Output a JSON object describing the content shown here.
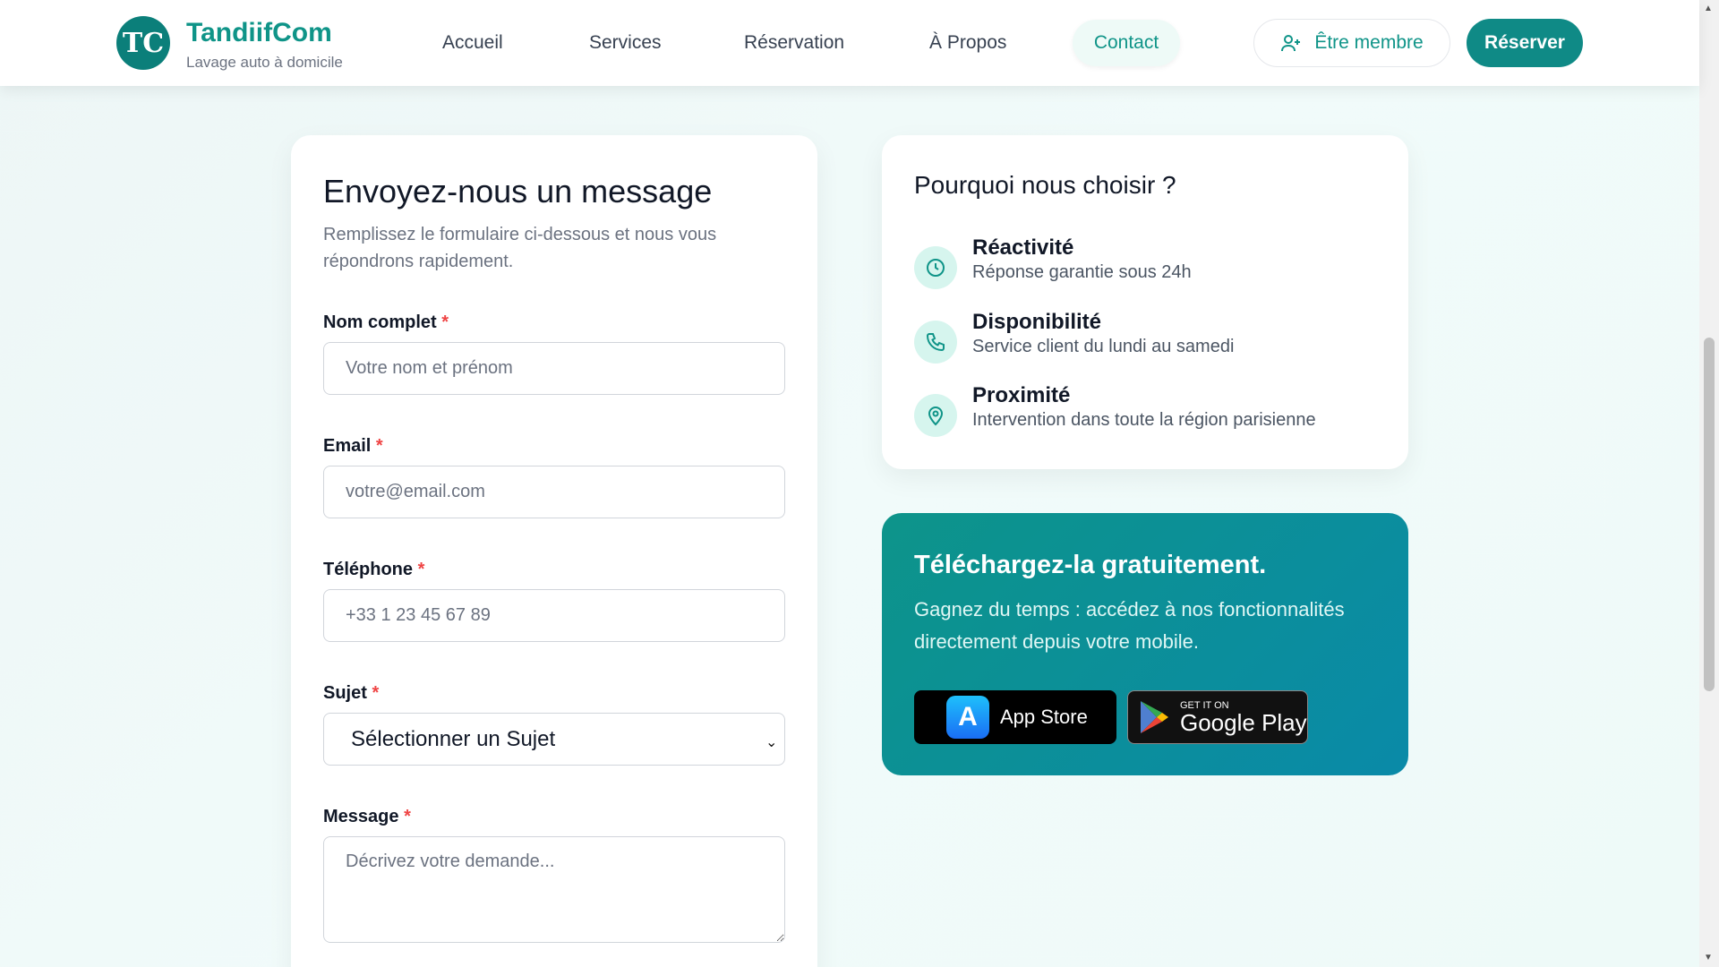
{
  "header": {
    "logo_letters": "TC",
    "brand": "TandiifCom",
    "tagline": "Lavage auto à domicile",
    "nav": [
      "Accueil",
      "Services",
      "Réservation",
      "À Propos",
      "Contact"
    ],
    "member_label": "Être membre",
    "reserve_label": "Réserver"
  },
  "form": {
    "title": "Envoyez-nous un message",
    "subtitle": "Remplissez le formulaire ci-dessous et nous vous répondrons rapidement.",
    "required_mark": "*",
    "name_label": "Nom complet",
    "name_placeholder": "Votre nom et prénom",
    "email_label": "Email",
    "email_placeholder": "votre@email.com",
    "phone_label": "Téléphone",
    "phone_placeholder": "+33 1 23 45 67 89",
    "subject_label": "Sujet",
    "subject_selected": "Sélectionner un Sujet",
    "message_label": "Message",
    "message_placeholder": "Décrivez votre demande..."
  },
  "why": {
    "title": "Pourquoi nous choisir ?",
    "items": [
      {
        "icon": "clock-icon",
        "title": "Réactivité",
        "desc": "Réponse garantie sous 24h"
      },
      {
        "icon": "phone-icon",
        "title": "Disponibilité",
        "desc": "Service client du lundi au samedi"
      },
      {
        "icon": "location-pin-icon",
        "title": "Proximité",
        "desc": "Intervention dans toute la région parisienne"
      }
    ]
  },
  "download": {
    "title": "Téléchargez-la gratuitement.",
    "desc": "Gagnez du temps : accédez à nos fonctionnalités directement depuis votre mobile.",
    "app_store": "App Store",
    "google_small": "GET IT ON",
    "google_big": "Google Play"
  },
  "colors": {
    "accent": "#0f9488",
    "button": "#0f8a86"
  }
}
